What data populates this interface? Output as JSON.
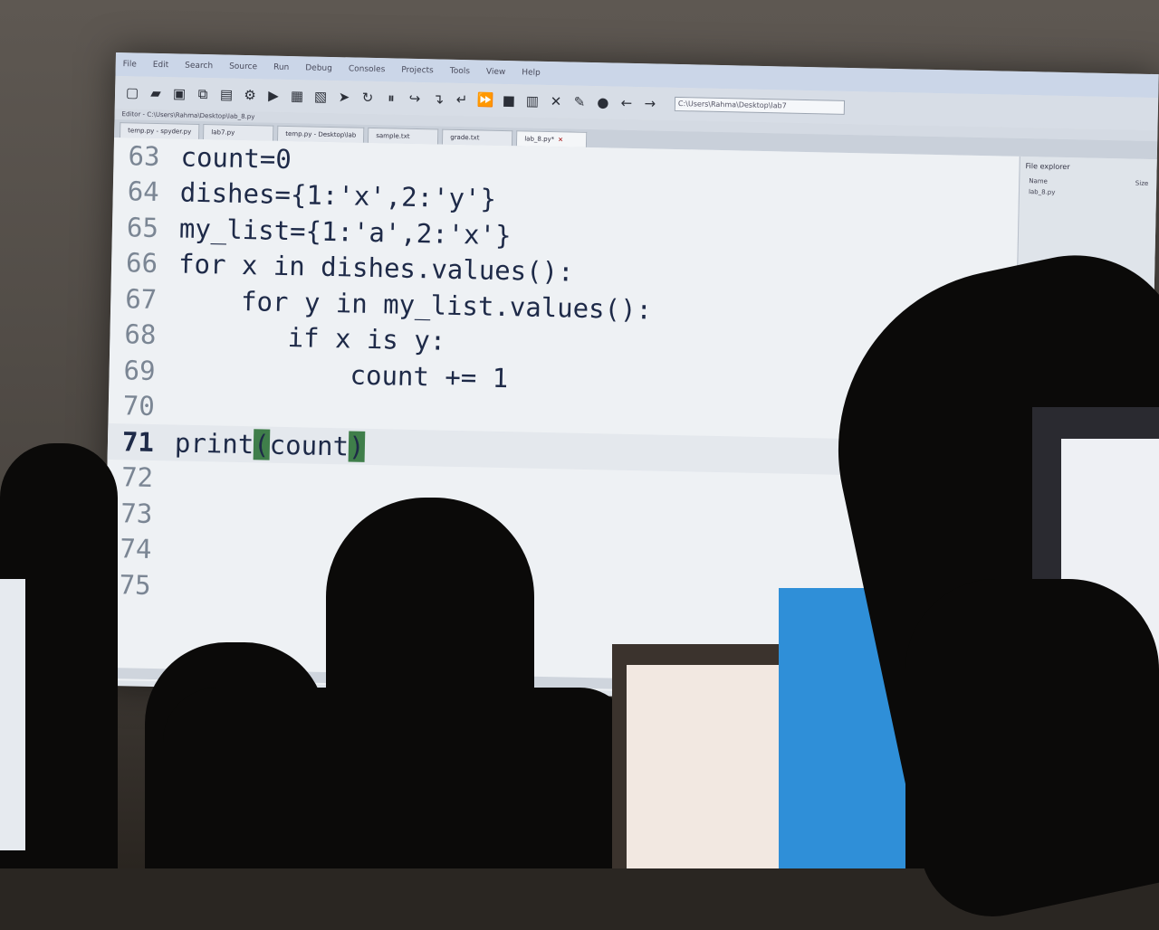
{
  "menubar": [
    "File",
    "Edit",
    "Search",
    "Source",
    "Run",
    "Debug",
    "Consoles",
    "Projects",
    "Tools",
    "View",
    "Help"
  ],
  "toolbar": {
    "icons": [
      "new-file-icon",
      "open-icon",
      "save-icon",
      "save-all-icon",
      "print-icon",
      "settings-icon",
      "run-icon",
      "run-cell-icon",
      "run-cell-advance-icon",
      "run-selection-icon",
      "rerun-icon",
      "debug-icon",
      "step-icon",
      "step-into-icon",
      "step-return-icon",
      "continue-icon",
      "stop-icon",
      "maximize-icon",
      "fullscreen-icon",
      "wrench-icon",
      "python-icon",
      "back-arrow-icon",
      "forward-arrow-icon"
    ],
    "path": "C:\\Users\\Rahma\\Desktop\\lab7"
  },
  "breadcrumb": "Editor - C:\\Users\\Rahma\\Desktop\\lab_8.py",
  "tabs": [
    {
      "label": "temp.py - spyder.py"
    },
    {
      "label": "lab7.py"
    },
    {
      "label": "temp.py - Desktop\\lab"
    },
    {
      "label": "sample.txt"
    },
    {
      "label": "grade.txt"
    },
    {
      "label": "lab_8.py*",
      "active": true
    }
  ],
  "editor": {
    "lines": [
      {
        "num": "63",
        "code": "count=0"
      },
      {
        "num": "64",
        "code": "dishes={1:'x',2:'y'}"
      },
      {
        "num": "65",
        "code": "my_list={1:'a',2:'x'}"
      },
      {
        "num": "66",
        "code": "for x in dishes.values():"
      },
      {
        "num": "67",
        "code": "    for y in my_list.values():"
      },
      {
        "num": "68",
        "code": "       if x is y:"
      },
      {
        "num": "69",
        "code": "           count += 1"
      },
      {
        "num": "70",
        "code": ""
      },
      {
        "num": "71",
        "code_pre": "print",
        "code_paren_open": "(",
        "code_mid": "count",
        "code_paren_close": ")",
        "current": true
      },
      {
        "num": "72",
        "code": ""
      },
      {
        "num": "73",
        "code": ""
      },
      {
        "num": "74",
        "code": ""
      },
      {
        "num": "75",
        "code": ""
      }
    ]
  },
  "side_panel": {
    "title": "File explorer",
    "header_name": "Name",
    "header_size": "Size",
    "file": "lab_8.py"
  },
  "colors": {
    "editor_bg": "#eef1f4",
    "code_text": "#1e2a48",
    "line_number": "#7b8694",
    "bracket_match": "#3f7e4a"
  }
}
